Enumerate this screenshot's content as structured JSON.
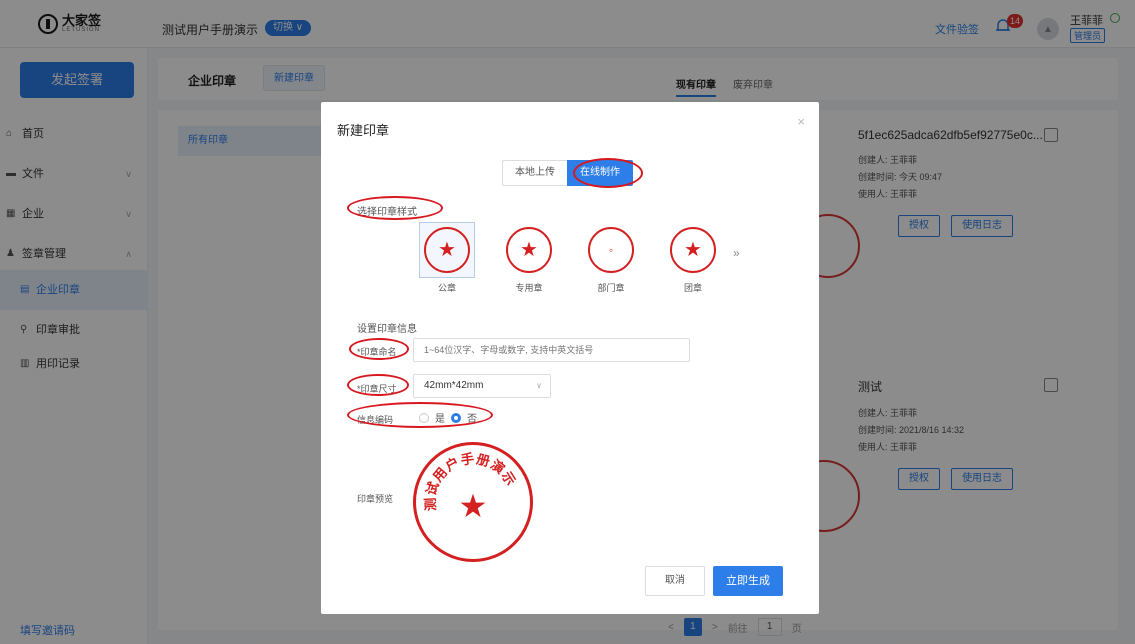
{
  "app": {
    "logo_text": "大家签",
    "logo_sub": "LETUSIGN",
    "org_name": "测试用户手册演示",
    "switch_label": "切换 ∨",
    "doc_verify": "文件验签",
    "notification_count": "14",
    "user_name": "王菲菲",
    "user_role": "管理员"
  },
  "sidebar": {
    "start_sign": "发起签署",
    "items": [
      {
        "icon": "home-icon",
        "glyph": "⌂",
        "label": "首页"
      },
      {
        "icon": "folder-icon",
        "glyph": "▬",
        "label": "文件",
        "chev": "∨"
      },
      {
        "icon": "building-icon",
        "glyph": "▦",
        "label": "企业",
        "chev": "∨"
      },
      {
        "icon": "seal-manage-icon",
        "glyph": "♟",
        "label": "签章管理",
        "chev": "∧"
      },
      {
        "icon": "seal-list-icon",
        "glyph": "▤",
        "label": "企业印章"
      },
      {
        "icon": "approval-icon",
        "glyph": "⚲",
        "label": "印章审批"
      },
      {
        "icon": "record-icon",
        "glyph": "▥",
        "label": "用印记录"
      }
    ],
    "invite": "填写邀请码"
  },
  "main": {
    "tab_title": "企业印章",
    "tab_new": "新建印章",
    "tab_current": "现有印章",
    "tab_abandoned": "废弃印章",
    "filter_all": "所有印章",
    "cards": [
      {
        "title": "5f1ec625adca62dfb5ef92775e0c...",
        "creator": "创建人: 王菲菲",
        "created": "创建时间: 今天 09:47",
        "user": "使用人: 王菲菲",
        "btn_auth": "授权",
        "btn_log": "使用日志"
      },
      {
        "title": "测试",
        "creator": "创建人: 王菲菲",
        "created": "创建时间: 2021/8/16 14:32",
        "user": "使用人: 王菲菲",
        "btn_auth": "授权",
        "btn_log": "使用日志"
      }
    ],
    "pager": {
      "prev": "<",
      "current": "1",
      "next": ">",
      "goto_label": "前往",
      "goto_value": "1",
      "page_suffix": "页"
    }
  },
  "modal": {
    "title": "新建印章",
    "close": "×",
    "seg_local": "本地上传",
    "seg_online": "在线制作",
    "select_style_label": "选择印章样式",
    "styles": [
      {
        "name": "公章",
        "selected": true
      },
      {
        "name": "专用章",
        "selected": false
      },
      {
        "name": "部门章",
        "selected": false
      },
      {
        "name": "团章",
        "selected": false
      }
    ],
    "more": "»",
    "info_label": "设置印章信息",
    "name_label": "*印章命名",
    "name_placeholder": "1~64位汉字、字母或数字, 支持中英文括号",
    "size_label": "*印章尺寸",
    "size_value": "42mm*42mm",
    "encode_label": "信息编码",
    "encode_yes": "是",
    "encode_no": "否",
    "preview_label": "印章预览",
    "preview_seal_text": "测试用户手册演示",
    "cancel": "取消",
    "generate": "立即生成"
  },
  "colors": {
    "accent": "#2d7ee8",
    "seal_red": "#d42020",
    "annotation_red": "#d8181f"
  }
}
